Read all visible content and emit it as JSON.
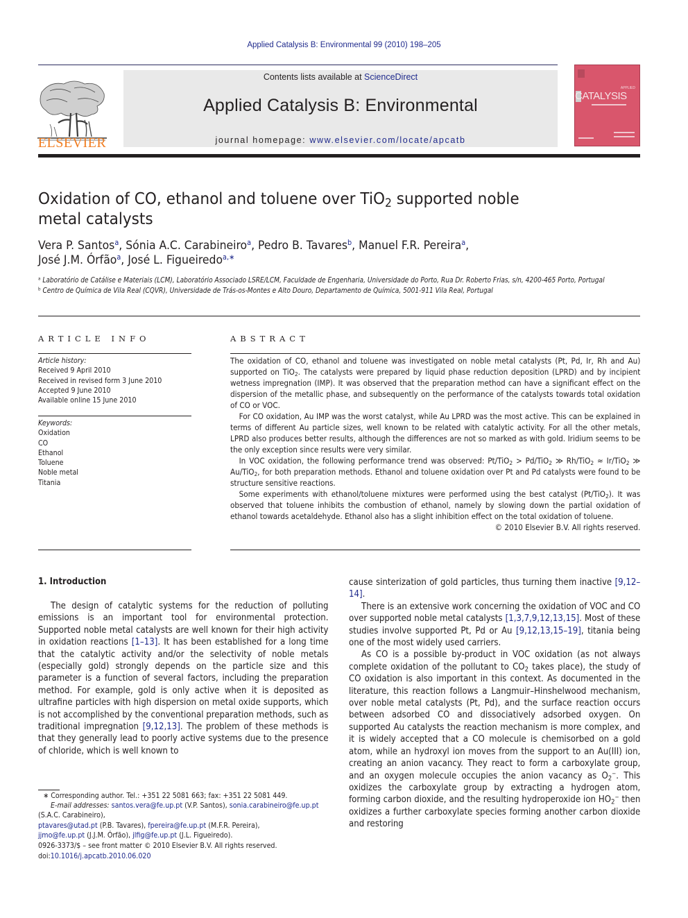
{
  "header": {
    "citation": "Applied Catalysis B: Environmental 99 (2010) 198–205",
    "contents_prefix": "Contents lists available at ",
    "contents_link": "ScienceDirect",
    "journal_title": "Applied Catalysis B: Environmental",
    "homepage_prefix": "journal homepage: ",
    "homepage_url": "www.elsevier.com/locate/apcatb",
    "publisher_logo": "ELSEVIER",
    "cover": {
      "label_small": "APPLIED",
      "label_big": "CATALYSIS",
      "color": "#d9566c"
    }
  },
  "article": {
    "title_part1": "Oxidation of CO, ethanol and toluene over TiO",
    "title_sub": "2",
    "title_part2": " supported noble metal catalysts",
    "authors": [
      {
        "name": "Vera P. Santos",
        "aff": "a",
        "sep": ", "
      },
      {
        "name": "Sónia A.C. Carabineiro",
        "aff": "a",
        "sep": ", "
      },
      {
        "name": "Pedro B. Tavares",
        "aff": "b",
        "sep": ", "
      },
      {
        "name": "Manuel F.R. Pereira",
        "aff": "a",
        "sep": ","
      },
      {
        "name": "José J.M. Órfão",
        "aff": "a",
        "sep": ", "
      },
      {
        "name": "José L. Figueiredo",
        "aff": "a,∗",
        "sep": ""
      }
    ],
    "affiliations": [
      {
        "mark": "a",
        "text": "Laboratório de Catálise e Materiais (LCM), Laboratório Associado LSRE/LCM, Faculdade de Engenharia, Universidade do Porto, Rua Dr. Roberto Frias, s/n, 4200-465 Porto, Portugal"
      },
      {
        "mark": "b",
        "text": "Centro de Química de Vila Real (CQVR), Universidade de Trás-os-Montes e Alto Douro, Departamento de Química, 5001-911 Vila Real, Portugal"
      }
    ]
  },
  "article_info": {
    "heading": "ARTICLE INFO",
    "history_label": "Article history:",
    "history": [
      "Received 9 April 2010",
      "Received in revised form 3 June 2010",
      "Accepted 9 June 2010",
      "Available online 15 June 2010"
    ],
    "keywords_label": "Keywords:",
    "keywords": [
      "Oxidation",
      "CO",
      "Ethanol",
      "Toluene",
      "Noble metal",
      "Titania"
    ]
  },
  "abstract": {
    "heading": "ABSTRACT",
    "p1_a": "The oxidation of CO, ethanol and toluene was investigated on noble metal catalysts (Pt, Pd, Ir, Rh and Au) supported on TiO",
    "p1_b": ". The catalysts were prepared by liquid phase reduction deposition (LPRD) and by incipient wetness impregnation (IMP). It was observed that the preparation method can have a significant effect on the dispersion of the metallic phase, and subsequently on the performance of the catalysts towards total oxidation of CO or VOC.",
    "p2": "For CO oxidation, Au IMP was the worst catalyst, while Au LPRD was the most active. This can be explained in terms of different Au particle sizes, well known to be related with catalytic activity. For all the other metals, LPRD also produces better results, although the differences are not so marked as with gold. Iridium seems to be the only exception since results were very similar.",
    "p3_a": "In VOC oxidation, the following performance trend was observed: Pt/TiO",
    "p3_b": " > Pd/TiO",
    "p3_c": " ≫ Rh/TiO",
    "p3_d": " ≈ Ir/TiO",
    "p3_e": " ≫ Au/TiO",
    "p3_f": ", for both preparation methods. Ethanol and toluene oxidation over Pt and Pd catalysts were found to be structure sensitive reactions.",
    "p4_a": "Some experiments with ethanol/toluene mixtures were performed using the best catalyst (Pt/TiO",
    "p4_b": "). It was observed that toluene inhibits the combustion of ethanol, namely by slowing down the partial oxidation of ethanol towards acetaldehyde. Ethanol also has a slight inhibition effect on the total oxidation of toluene.",
    "copyright": "© 2010 Elsevier B.V. All rights reserved.",
    "sub2": "2"
  },
  "introduction": {
    "heading": "1.  Introduction",
    "left_a": "The design of catalytic systems for the reduction of polluting emissions is an important tool for environmental protection. Supported noble metal catalysts are well known for their high activity in oxidation reactions ",
    "ref_1": "[1–13]",
    "left_b": ". It has been established for a long time that the catalytic activity and/or the selectivity of noble metals (especially gold) strongly depends on the particle size and this parameter is a function of several factors, including the preparation method. For example, gold is only active when it is deposited as ultrafine particles with high dispersion on metal oxide supports, which is not accomplished by the conventional preparation methods, such as traditional impregnation ",
    "ref_2": "[9,12,13]",
    "left_c": ". The problem of these methods is that they generally lead to poorly active systems due to the presence of chloride, which is well known to",
    "right_p1_a": "cause sinterization of gold particles, thus turning them inactive ",
    "ref_3": "[9,12–14]",
    "right_p1_b": ".",
    "right_p2_a": "There is an extensive work concerning the oxidation of VOC and CO over supported noble metal catalysts ",
    "ref_4": "[1,3,7,9,12,13,15]",
    "right_p2_b": ". Most of these studies involve supported Pt, Pd or Au ",
    "ref_5": "[9,12,13,15–19]",
    "right_p2_c": ", titania being one of the most widely used carriers.",
    "right_p3_a": "As CO is a possible by-product in VOC oxidation (as not always complete oxidation of the pollutant to CO",
    "right_p3_b": " takes place), the study of CO oxidation is also important in this context. As documented in the literature, this reaction follows a Langmuir–Hinshelwood mechanism, over noble metal catalysts (Pt, Pd), and the surface reaction occurs between adsorbed CO and dissociatively adsorbed oxygen. On supported Au catalysts the reaction mechanism is more complex, and it is widely accepted that a CO molecule is chemisorbed on a gold atom, while an hydroxyl ion moves from the support to an Au(III) ion, creating an anion vacancy. They react to form a carboxylate group, and an oxygen molecule occupies the anion vacancy as O",
    "right_p3_c": ". This oxidizes the carboxylate group by extracting a hydrogen atom, forming carbon dioxide, and the resulting hydroperoxide ion HO",
    "right_p3_d": " then oxidizes a further carboxylate species forming another carbon dioxide and restoring",
    "minus": "−"
  },
  "footnotes": {
    "corresponding": "∗ Corresponding author. Tel.: +351 22 5081 663; fax: +351 22 5081 449.",
    "email_label": "E-mail addresses:",
    "emails": [
      {
        "email": "santos.vera@fe.up.pt",
        "who": " (V.P. Santos), "
      },
      {
        "email": "sonia.carabineiro@fe.up.pt",
        "who": " (S.A.C. Carabineiro), "
      },
      {
        "email": "ptavares@utad.pt",
        "who": " (P.B. Tavares), "
      },
      {
        "email": "fpereira@fe.up.pt",
        "who": " (M.F.R. Pereira), "
      },
      {
        "email": "jjmo@fe.up.pt",
        "who": " (J.J.M. Órfão), "
      },
      {
        "email": "jlfig@fe.up.pt",
        "who": " (J.L. Figueiredo)."
      }
    ],
    "front_matter": "0926-3373/$ – see front matter © 2010 Elsevier B.V. All rights reserved.",
    "doi_label": "doi:",
    "doi": "10.1016/j.apcatb.2010.06.020"
  }
}
